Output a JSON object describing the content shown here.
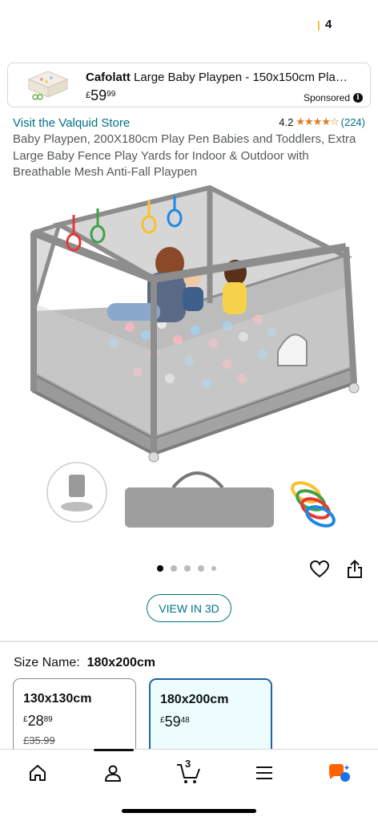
{
  "status": {
    "count": "4"
  },
  "sponsored_ad": {
    "brand": "Cafolatt",
    "title": "Large Baby Playpen - 150x150cm Pla…",
    "currency": "£",
    "price_whole": "59",
    "price_fraction": "99",
    "label": "Sponsored",
    "info_glyph": "i"
  },
  "store": {
    "link": "Visit the Valquid Store",
    "rating": "4.2",
    "stars": "★★★★☆",
    "review_count": "(224)"
  },
  "product": {
    "title": "Baby Playpen, 200X180cm Play Pen Babies and Toddlers, Extra Large Baby Fence Play Yards for Indoor & Outdoor with Breathable Mesh Anti-Fall Playpen"
  },
  "carousel": {
    "total": 5,
    "active_index": 0
  },
  "buttons": {
    "view_3d": "VIEW IN 3D"
  },
  "size": {
    "label": "Size Name:",
    "selected": "180x200cm",
    "options": [
      {
        "name": "130x130cm",
        "currency": "£",
        "whole": "28",
        "fraction": "89",
        "was": "£35.99"
      },
      {
        "name": "180x200cm",
        "currency": "£",
        "whole": "59",
        "fraction": "48"
      }
    ]
  },
  "nav": {
    "icons": [
      "home-icon",
      "account-icon",
      "cart-icon",
      "menu-icon",
      "rufus-icon"
    ],
    "cart_count": "3"
  },
  "colors": {
    "link": "#007185",
    "star": "#de7921",
    "selected_border": "#2162a1",
    "rufus": "#ff6200"
  }
}
